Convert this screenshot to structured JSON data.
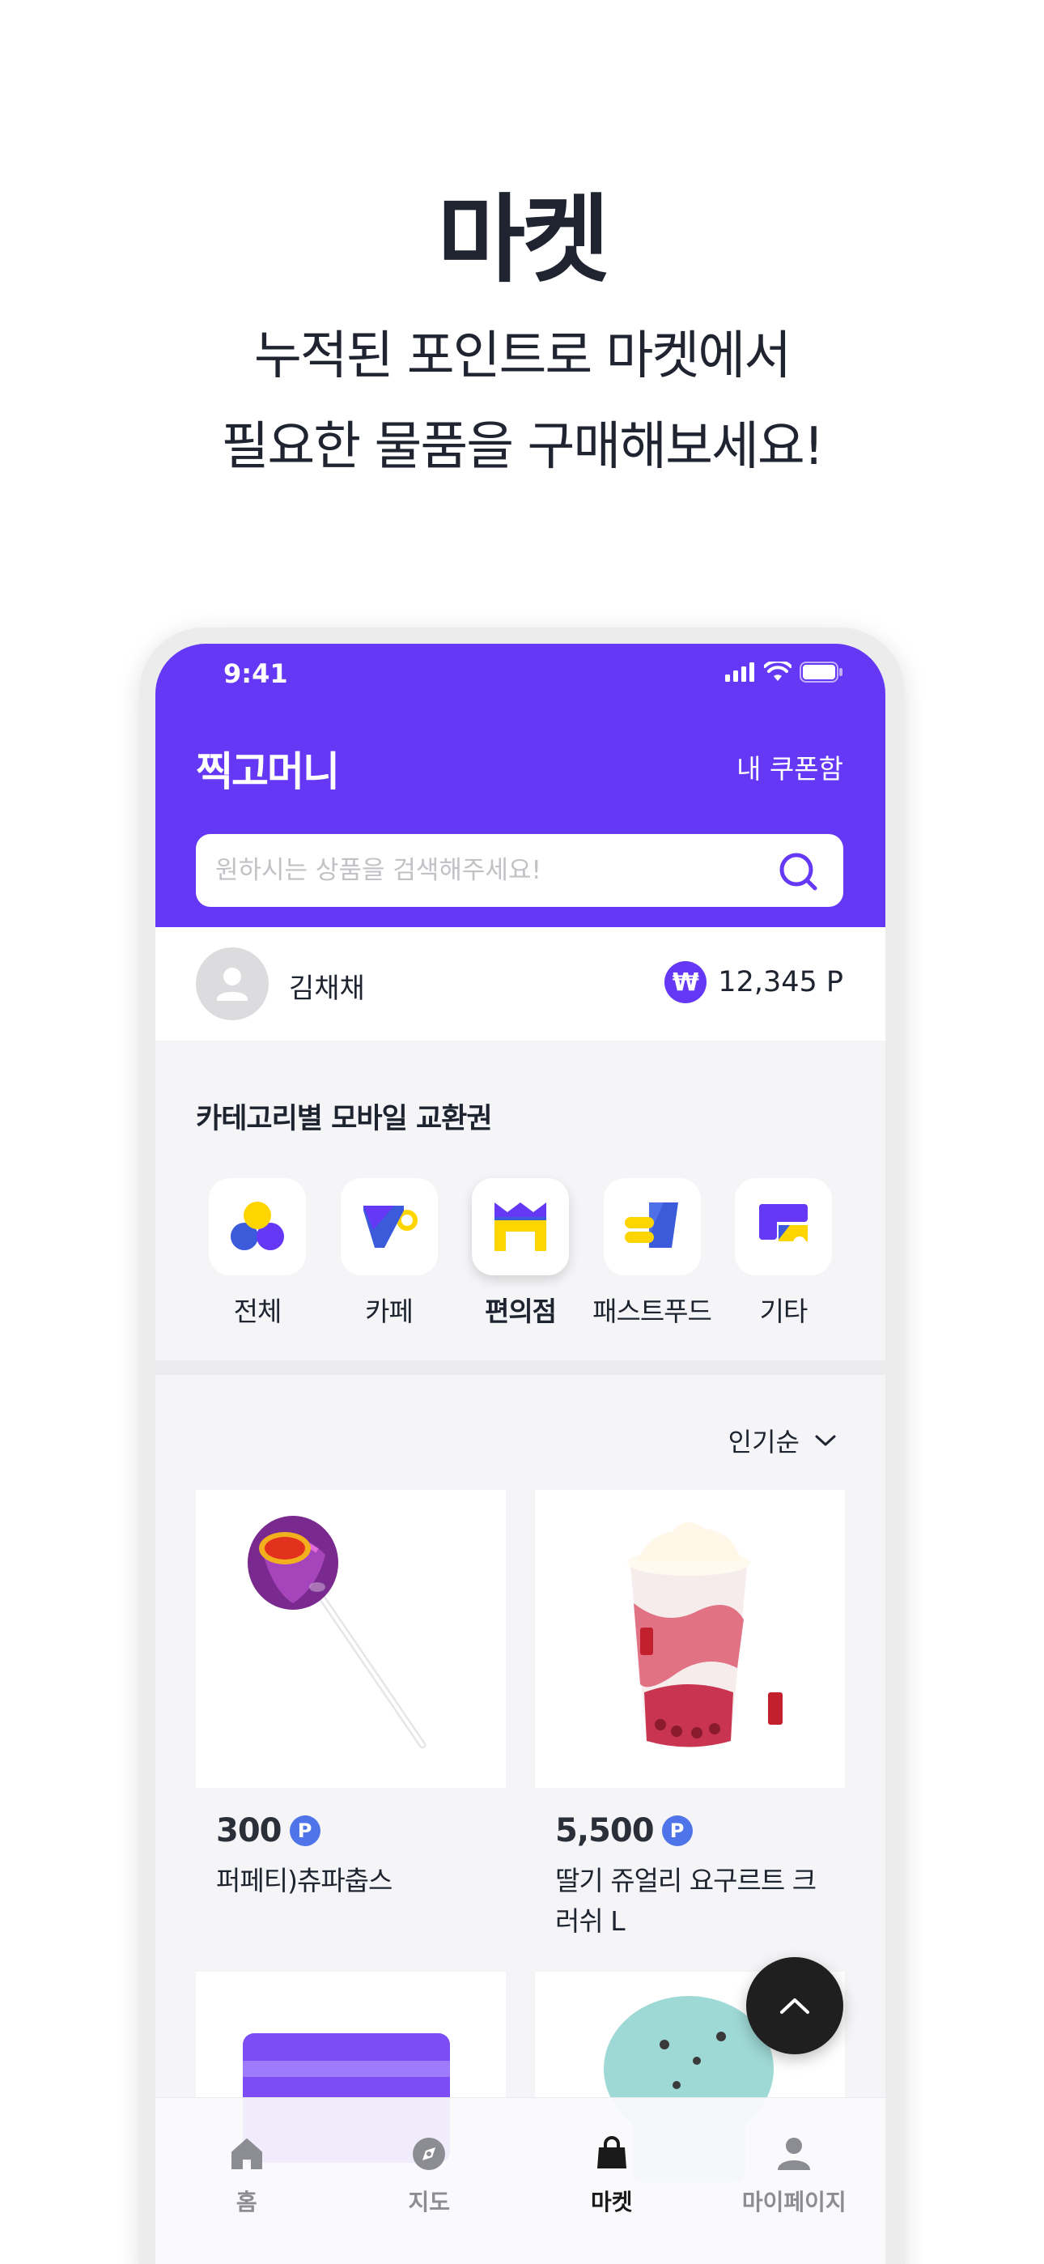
{
  "promo": {
    "title": "마켓",
    "subtitle_line1": "누적된 포인트로 마켓에서",
    "subtitle_line2": "필요한 물품을 구매해보세요!"
  },
  "status_bar": {
    "time": "9:41"
  },
  "header": {
    "brand": "찍고머니",
    "coupon_link": "내 쿠폰함",
    "search_placeholder": "원하시는 상품을 검색해주세요!"
  },
  "user": {
    "name": "김채채",
    "points": "12,345 P",
    "point_icon": "₩"
  },
  "categories": {
    "title": "카테고리별 모바일 교환권",
    "items": [
      {
        "label": "전체",
        "icon": "all-icon"
      },
      {
        "label": "카페",
        "icon": "cafe-icon"
      },
      {
        "label": "편의점",
        "icon": "convenience-store-icon",
        "active": true
      },
      {
        "label": "패스트푸드",
        "icon": "fastfood-icon"
      },
      {
        "label": "기타",
        "icon": "etc-icon"
      }
    ]
  },
  "sort": {
    "selected": "인기순"
  },
  "products": [
    {
      "price": "300",
      "badge": "P",
      "name": "퍼페티)츄파춥스"
    },
    {
      "price": "5,500",
      "badge": "P",
      "name": "딸기 쥬얼리 요구르트 크러쉬 L"
    }
  ],
  "tabs": [
    {
      "label": "홈",
      "icon": "home-icon"
    },
    {
      "label": "지도",
      "icon": "map-compass-icon"
    },
    {
      "label": "마켓",
      "icon": "shopping-bag-icon",
      "active": true
    },
    {
      "label": "마이페이지",
      "icon": "person-icon"
    }
  ],
  "colors": {
    "brand": "#6438f5",
    "point_badge": "#4f74ea",
    "yellow": "#ffd500",
    "blue": "#3b5bdb"
  }
}
